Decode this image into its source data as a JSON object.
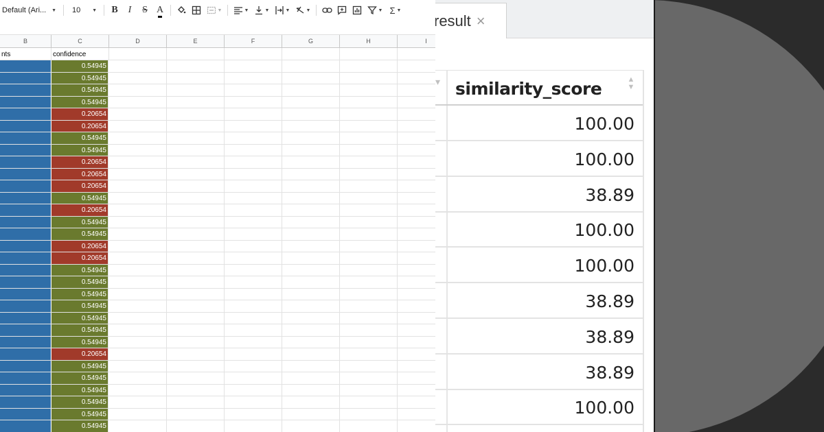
{
  "spreadsheet": {
    "toolbar": {
      "font_name": "Default (Ari...",
      "font_size": "10",
      "bold": "B",
      "italic": "I",
      "strikethrough": "S",
      "text_color": "A",
      "sum": "Σ"
    },
    "columns": [
      "B",
      "C",
      "D",
      "E",
      "F",
      "G",
      "H",
      "I"
    ],
    "header_row": {
      "B": "nts",
      "C": "confidence"
    },
    "confidence_values": [
      "0.54945",
      "0.54945",
      "0.54945",
      "0.54945",
      "0.20654",
      "0.20654",
      "0.54945",
      "0.54945",
      "0.20654",
      "0.20654",
      "0.20654",
      "0.54945",
      "0.20654",
      "0.54945",
      "0.54945",
      "0.20654",
      "0.20654",
      "0.54945",
      "0.54945",
      "0.54945",
      "0.54945",
      "0.54945",
      "0.54945",
      "0.54945",
      "0.20654",
      "0.54945",
      "0.54945",
      "0.54945",
      "0.54945",
      "0.54945",
      "0.54945"
    ],
    "colors": {
      "column_b": "#2f6ea8",
      "high": "#6a7a2e",
      "low": "#a13a2a"
    }
  },
  "result_panel": {
    "tab_label": "result",
    "tab_close": "×",
    "column_header": "similarity_score",
    "values": [
      "100.00",
      "100.00",
      "38.89",
      "100.00",
      "100.00",
      "38.89",
      "38.89",
      "38.89",
      "100.00"
    ]
  }
}
